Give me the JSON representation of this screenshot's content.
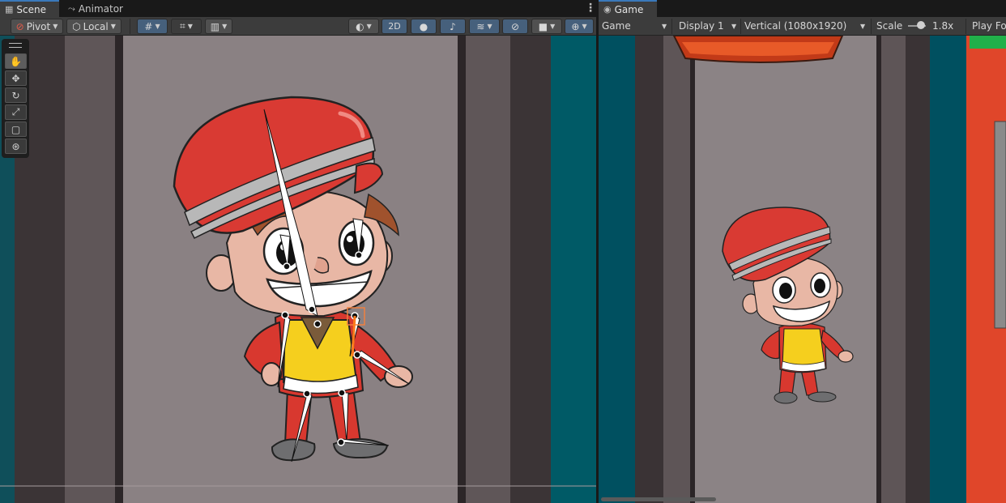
{
  "scene_tab": {
    "title": "Scene"
  },
  "animator_tab": {
    "title": "Animator"
  },
  "game_tab": {
    "title": "Game"
  },
  "scene_toolbar": {
    "pivot_label": "Pivot",
    "local_label": "Local",
    "twod_label": "2D"
  },
  "game_toolbar": {
    "mode_label": "Game",
    "display_label": "Display 1",
    "resolution_label": "Vertical (1080x1920)",
    "scale_label": "Scale",
    "scale_value": "1.8x",
    "play_focus_label": "Play Fo"
  },
  "icons": [
    "scene-grid-icon",
    "animator-icon",
    "gamepad-icon",
    "hand-tool-icon",
    "move-tool-icon",
    "rotate-tool-icon",
    "scale-tool-icon",
    "rect-tool-icon",
    "transform-tool-icon",
    "bulb-icon",
    "audio-mute-icon",
    "effects-icon",
    "hidden-eye-icon",
    "camera-icon",
    "gizmo-icon"
  ],
  "colors": {
    "accent_blue": "#3a79bb",
    "bg_teal": "#005060",
    "wall_gray": "#8a8183",
    "hat_red": "#d93a33",
    "vest_yellow": "#f5cf1e",
    "game_orange": "#e0462a"
  }
}
